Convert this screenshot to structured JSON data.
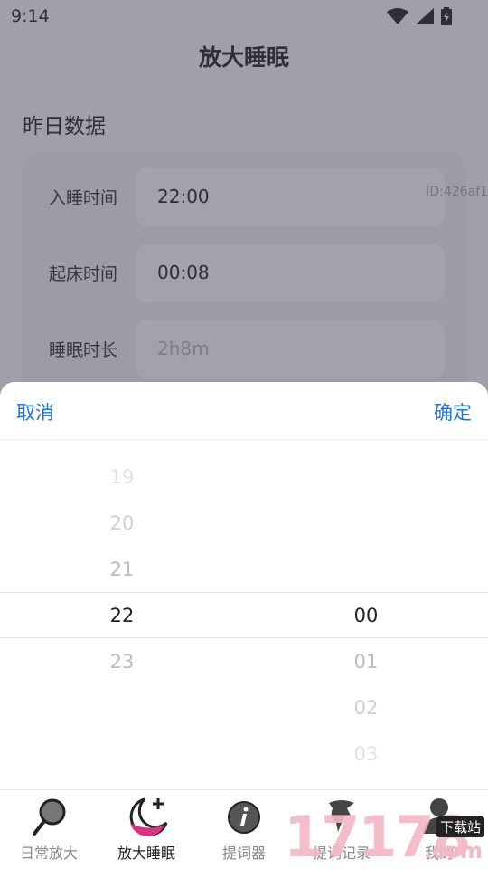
{
  "status": {
    "time": "9:14"
  },
  "header": {
    "title": "放大睡眠"
  },
  "section": {
    "title": "昨日数据"
  },
  "rows": [
    {
      "label": "入睡时间",
      "value": "22:00"
    },
    {
      "label": "起床时间",
      "value": "00:08"
    },
    {
      "label": "睡眠时长",
      "placeholder": "2h8m"
    }
  ],
  "watermark_id": "ID:426af1",
  "picker": {
    "cancel_label": "取消",
    "confirm_label": "确定",
    "hours": [
      "19",
      "20",
      "21",
      "22",
      "23"
    ],
    "selected_hour": "22",
    "minutes": [
      "00",
      "01",
      "02",
      "03"
    ],
    "selected_minute": "00"
  },
  "tabs": [
    {
      "label": "日常放大",
      "icon": "magnifier-icon"
    },
    {
      "label": "放大睡眠",
      "icon": "moon-plus-icon",
      "active": true
    },
    {
      "label": "提词器",
      "icon": "info-icon"
    },
    {
      "label": "提词记录",
      "icon": "bird-icon"
    },
    {
      "label": "我的",
      "icon": "user-icon"
    }
  ],
  "logo_watermark": {
    "digits": "17178",
    "badge": "下载站",
    "suffix": ".com"
  },
  "colors": {
    "accent": "#1a73e8",
    "overlay": "#3c3c50",
    "moon": "#d63384"
  }
}
